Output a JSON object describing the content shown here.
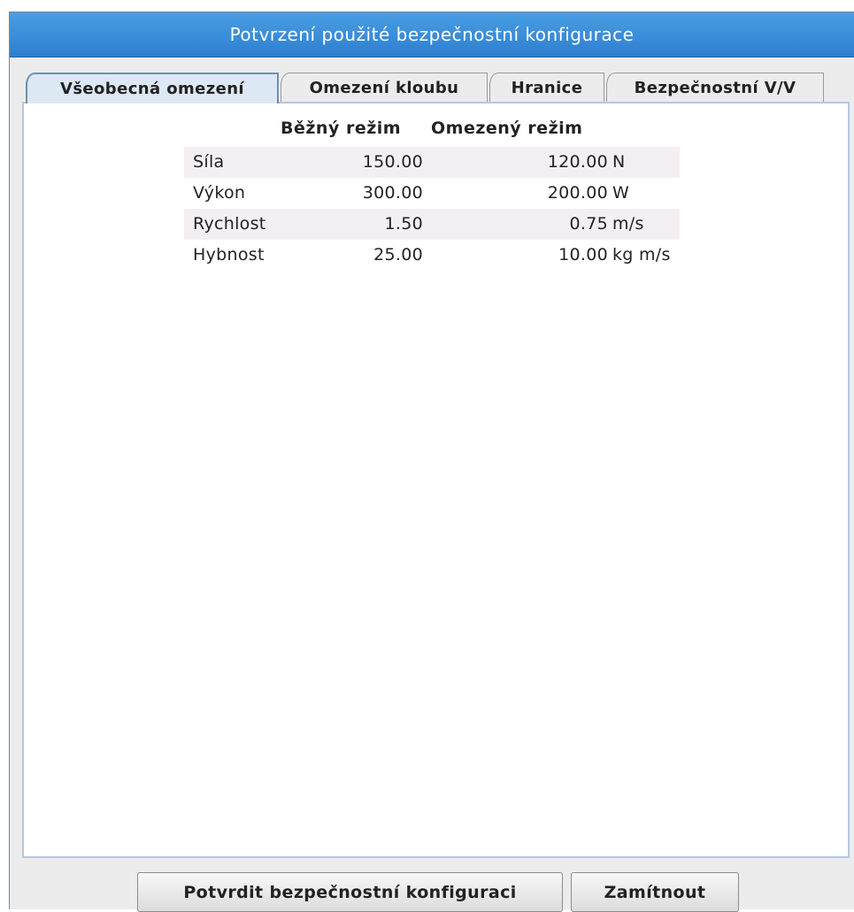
{
  "window": {
    "title": "Potvrzení použité bezpečnostní konfigurace"
  },
  "tabs": [
    {
      "label": "Všeobecná omezení",
      "active": true
    },
    {
      "label": "Omezení kloubu",
      "active": false
    },
    {
      "label": "Hranice",
      "active": false
    },
    {
      "label": "Bezpečnostní V/V",
      "active": false
    }
  ],
  "limits": {
    "headers": {
      "normal": "Běžný režim",
      "reduced": "Omezený režim"
    },
    "rows": [
      {
        "label": "Síla",
        "normal": "150.00",
        "reduced": "120.00",
        "unit": "N"
      },
      {
        "label": "Výkon",
        "normal": "300.00",
        "reduced": "200.00",
        "unit": "W"
      },
      {
        "label": "Rychlost",
        "normal": "1.50",
        "reduced": "0.75",
        "unit": "m/s"
      },
      {
        "label": "Hybnost",
        "normal": "25.00",
        "reduced": "10.00",
        "unit": "kg m/s"
      }
    ]
  },
  "buttons": {
    "confirm": "Potvrdit bezpečnostní konfiguraci",
    "reject": "Zamítnout"
  }
}
